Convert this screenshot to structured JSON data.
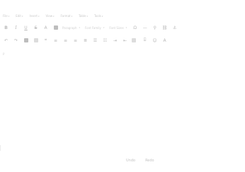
{
  "menubar": {
    "items": [
      "File",
      "Edit",
      "Insert",
      "View",
      "Format",
      "Table",
      "Tools"
    ]
  },
  "toolbar1": {
    "bold": "B",
    "italic": "I",
    "underline": "U",
    "strike": "S",
    "text_color": "A",
    "paragraph_label": "Paragraph",
    "font_family_label": "Font Family",
    "font_size_label": "Font Sizes",
    "special_char": "Ω",
    "hr": "—"
  },
  "toolbar2": {
    "table_size_label": "",
    "emoticons": "☺",
    "font_glyph": "A"
  },
  "status": {
    "path": "p",
    "word_count": ""
  },
  "footer": {
    "left": "Undo",
    "right": "Redo"
  }
}
